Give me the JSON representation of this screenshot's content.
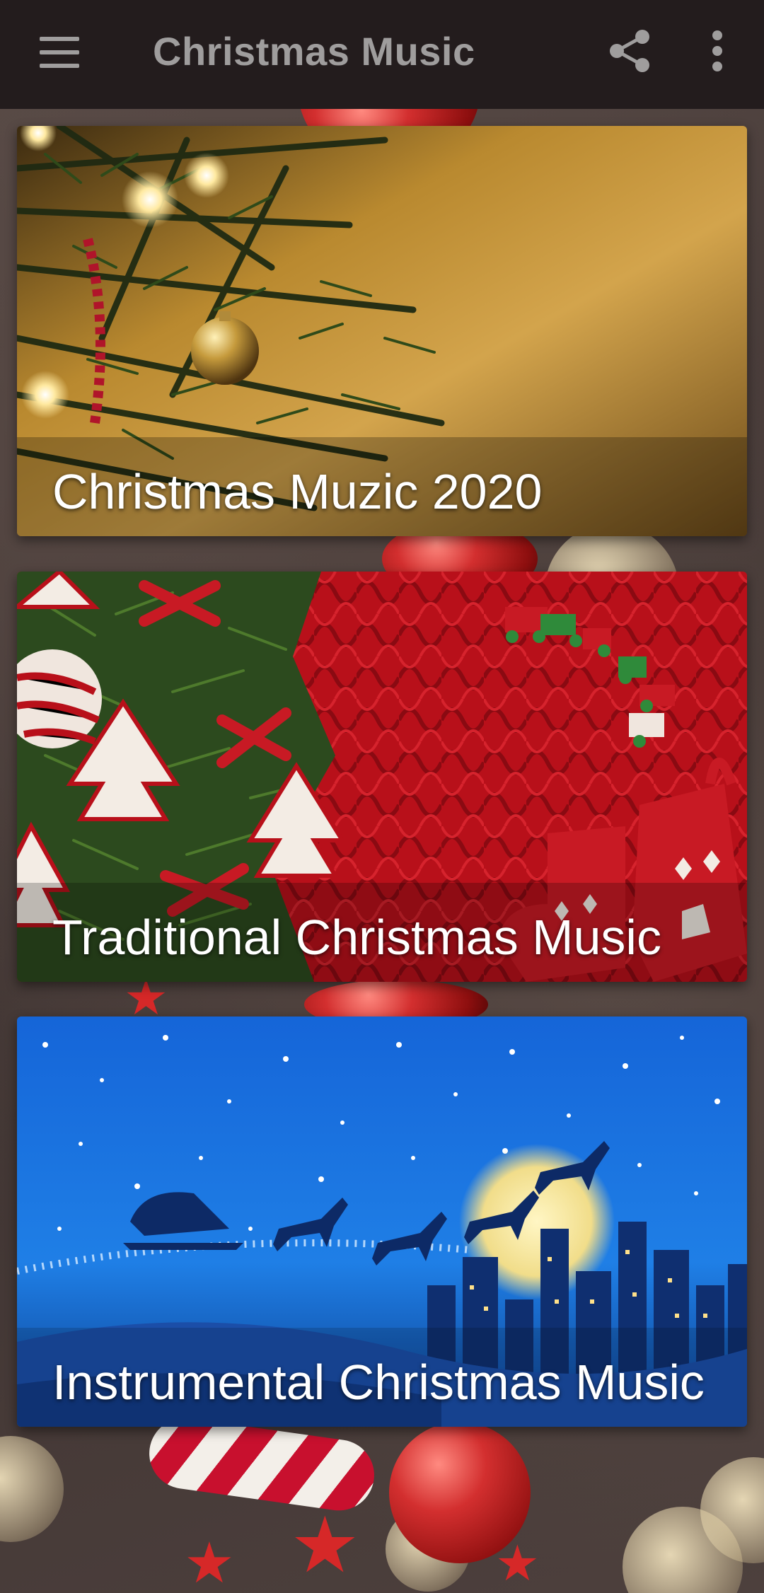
{
  "app_bar": {
    "title": "Christmas Music",
    "menu_icon": "hamburger-menu-icon",
    "share_icon": "share-icon",
    "more_icon": "more-vert-icon",
    "background": "#231c1d",
    "text_color": "#9f9d9d"
  },
  "playlists": [
    {
      "title": "Christmas Muzic 2020",
      "artwork": "christmas-tree-golden-lights"
    },
    {
      "title": "Traditional Christmas Music",
      "artwork": "red-knit-sweater-and-ornaments"
    },
    {
      "title": "Instrumental Christmas Music",
      "artwork": "santa-sleigh-over-night-city"
    }
  ]
}
